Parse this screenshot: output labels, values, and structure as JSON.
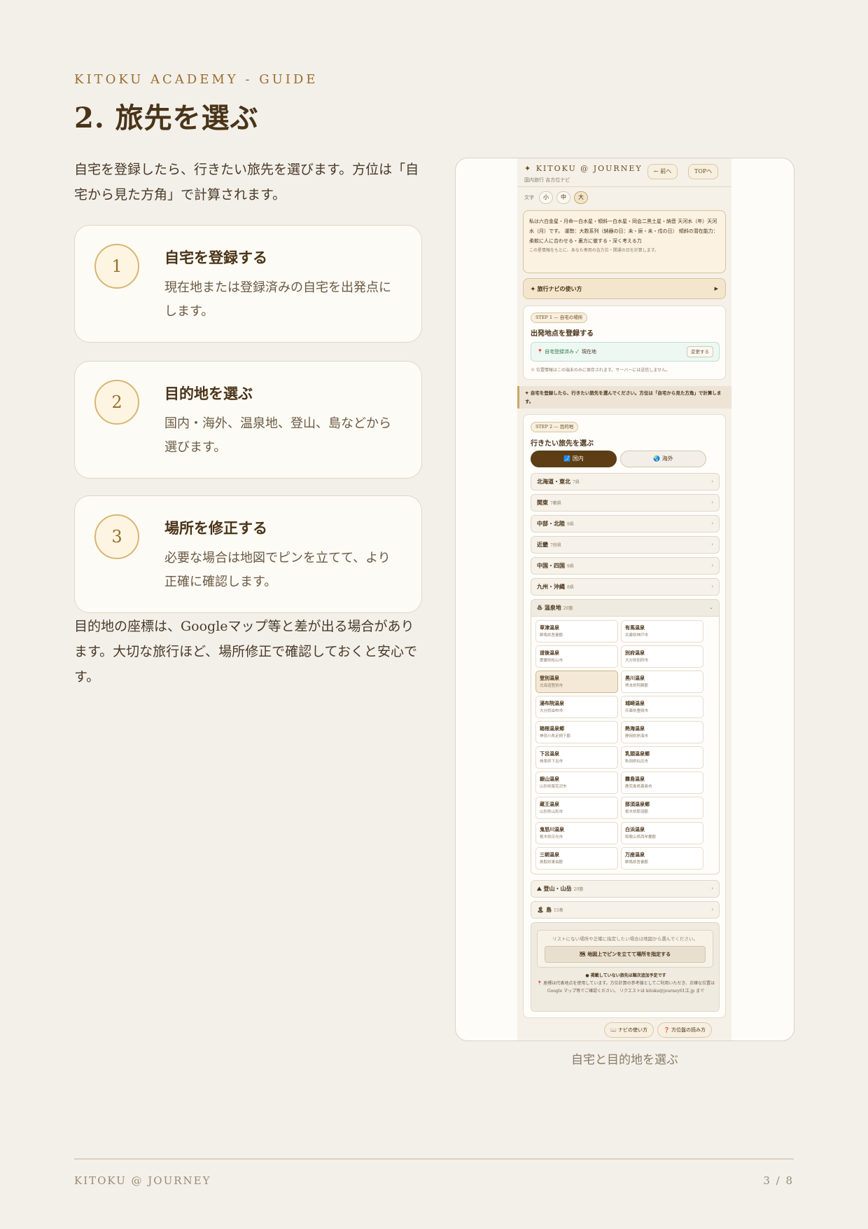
{
  "header": {
    "eyebrow": "KITOKU ACADEMY - GUIDE",
    "title": "2. 旅先を選ぶ"
  },
  "intro": "自宅を登録したら、行きたい旅先を選びます。方位は「自宅から見た方角」で計算されます。",
  "steps": [
    {
      "num": "1",
      "title": "自宅を登録する",
      "desc": "現在地または登録済みの自宅を出発点にします。"
    },
    {
      "num": "2",
      "title": "目的地を選ぶ",
      "desc": "国内・海外、温泉地、登山、島などから選びます。"
    },
    {
      "num": "3",
      "title": "場所を修正する",
      "desc": "必要な場合は地図でピンを立てて、より正確に確認します。"
    }
  ],
  "note": "目的地の座標は、Googleマップ等と差が出る場合があります。大切な旅行ほど、場所修正で確認しておくと安心です。",
  "screenshot": {
    "brand": "✦ KITOKU @ JOURNEY",
    "subtitle": "国内旅行 吉方位ナビ",
    "back_btn": "← 前へ",
    "top_btn": "TOPへ",
    "font_label": "文字",
    "font_sizes": [
      "小",
      "中",
      "大"
    ],
    "info_text": "私は六白金星・月命一白水星・傾斜一白水星・同会二黒土星・納音 天河水（年）天河水（月）です。 運勢：大数系列（納器の日：未・辰・未・戌の日） 傾斜の潜在能力：柔軟に人に合わせる・裏方に徹する・深く考える力",
    "info_small": "この星情報をもとに、あなた専用の吉方位・開運の日を計算します。",
    "howto": "✦ 旅行ナビの使い方",
    "howto_arrow": "▶",
    "step1": {
      "badge": "STEP 1 — 自宅の場所",
      "heading": "出発地点を登録する",
      "status": "📍 自宅登録済み ✓",
      "location": "現在地",
      "change_btn": "変更する",
      "note": "※ 位置情報はこの端末のみに保存されます。サーバーには送信しません。"
    },
    "strip": "✦ 自宅を登録したら、行きたい旅先を選んでください。方位は「自宅から見た方角」で計算します。",
    "step2": {
      "badge": "STEP 2 — 目的地",
      "heading": "行きたい旅先を選ぶ",
      "domestic": "🗾 国内",
      "overseas": "🌏 海外"
    },
    "regions": [
      {
        "name": "北海道・東北",
        "count": "7県"
      },
      {
        "name": "関東",
        "count": "7都県"
      },
      {
        "name": "中部・北陸",
        "count": "9県"
      },
      {
        "name": "近畿",
        "count": "7府県"
      },
      {
        "name": "中国・四国",
        "count": "9県"
      },
      {
        "name": "九州・沖縄",
        "count": "8県"
      }
    ],
    "onsen": {
      "name": "♨ 温泉地",
      "count": "20箇"
    },
    "onsen_list": [
      {
        "name": "草津温泉",
        "place": "群馬県吾妻郡"
      },
      {
        "name": "有馬温泉",
        "place": "兵庫県神戸市"
      },
      {
        "name": "道後温泉",
        "place": "愛媛県松山市"
      },
      {
        "name": "別府温泉",
        "place": "大分県別府市"
      },
      {
        "name": "登別温泉",
        "place": "北海道登別市"
      },
      {
        "name": "黒川温泉",
        "place": "熊本県阿蘇郡"
      },
      {
        "name": "湯布院温泉",
        "place": "大分県由布市"
      },
      {
        "name": "城崎温泉",
        "place": "兵庫県豊岡市"
      },
      {
        "name": "箱根温泉郷",
        "place": "神奈川県足柄下郡"
      },
      {
        "name": "熱海温泉",
        "place": "静岡県熱海市"
      },
      {
        "name": "下呂温泉",
        "place": "岐阜県下呂市"
      },
      {
        "name": "乳頭温泉郷",
        "place": "秋田県仙北市"
      },
      {
        "name": "銀山温泉",
        "place": "山形県尾花沢市"
      },
      {
        "name": "霧島温泉",
        "place": "鹿児島県霧島市"
      },
      {
        "name": "蔵王温泉",
        "place": "山形県山形市"
      },
      {
        "name": "那須温泉郷",
        "place": "栃木県那須郡"
      },
      {
        "name": "鬼怒川温泉",
        "place": "栃木県日光市"
      },
      {
        "name": "白浜温泉",
        "place": "和歌山県西牟婁郡"
      },
      {
        "name": "三朝温泉",
        "place": "鳥取県東伯郡"
      },
      {
        "name": "万座温泉",
        "place": "群馬県吾妻郡"
      }
    ],
    "mountain": {
      "name": "⛰ 登山・山岳",
      "count": "20箇"
    },
    "island": {
      "name": "🏝 島",
      "count": "15島"
    },
    "map_hint": "リストにない場所や正確に指定したい場合は地図から選んでください。",
    "map_btn": "🗺 地図上でピンを立てて場所を指定する",
    "foot1": "● 掲載していない旅先は順次追加予定です",
    "foot2": "📍 座標は代表地点を使用しています。方位計算の参考値としてご利用いただき、正確な位置はGoogle マップ等でご確認ください。 リクエストは kitoku@journey61江.jp まで",
    "bottom_howto": "📖 ナビの使い方",
    "bottom_reading": "❓ 方位盤の読み方"
  },
  "caption": "自宅と目的地を選ぶ",
  "footer": {
    "left": "KITOKU @ JOURNEY",
    "right": "3 / 8"
  }
}
